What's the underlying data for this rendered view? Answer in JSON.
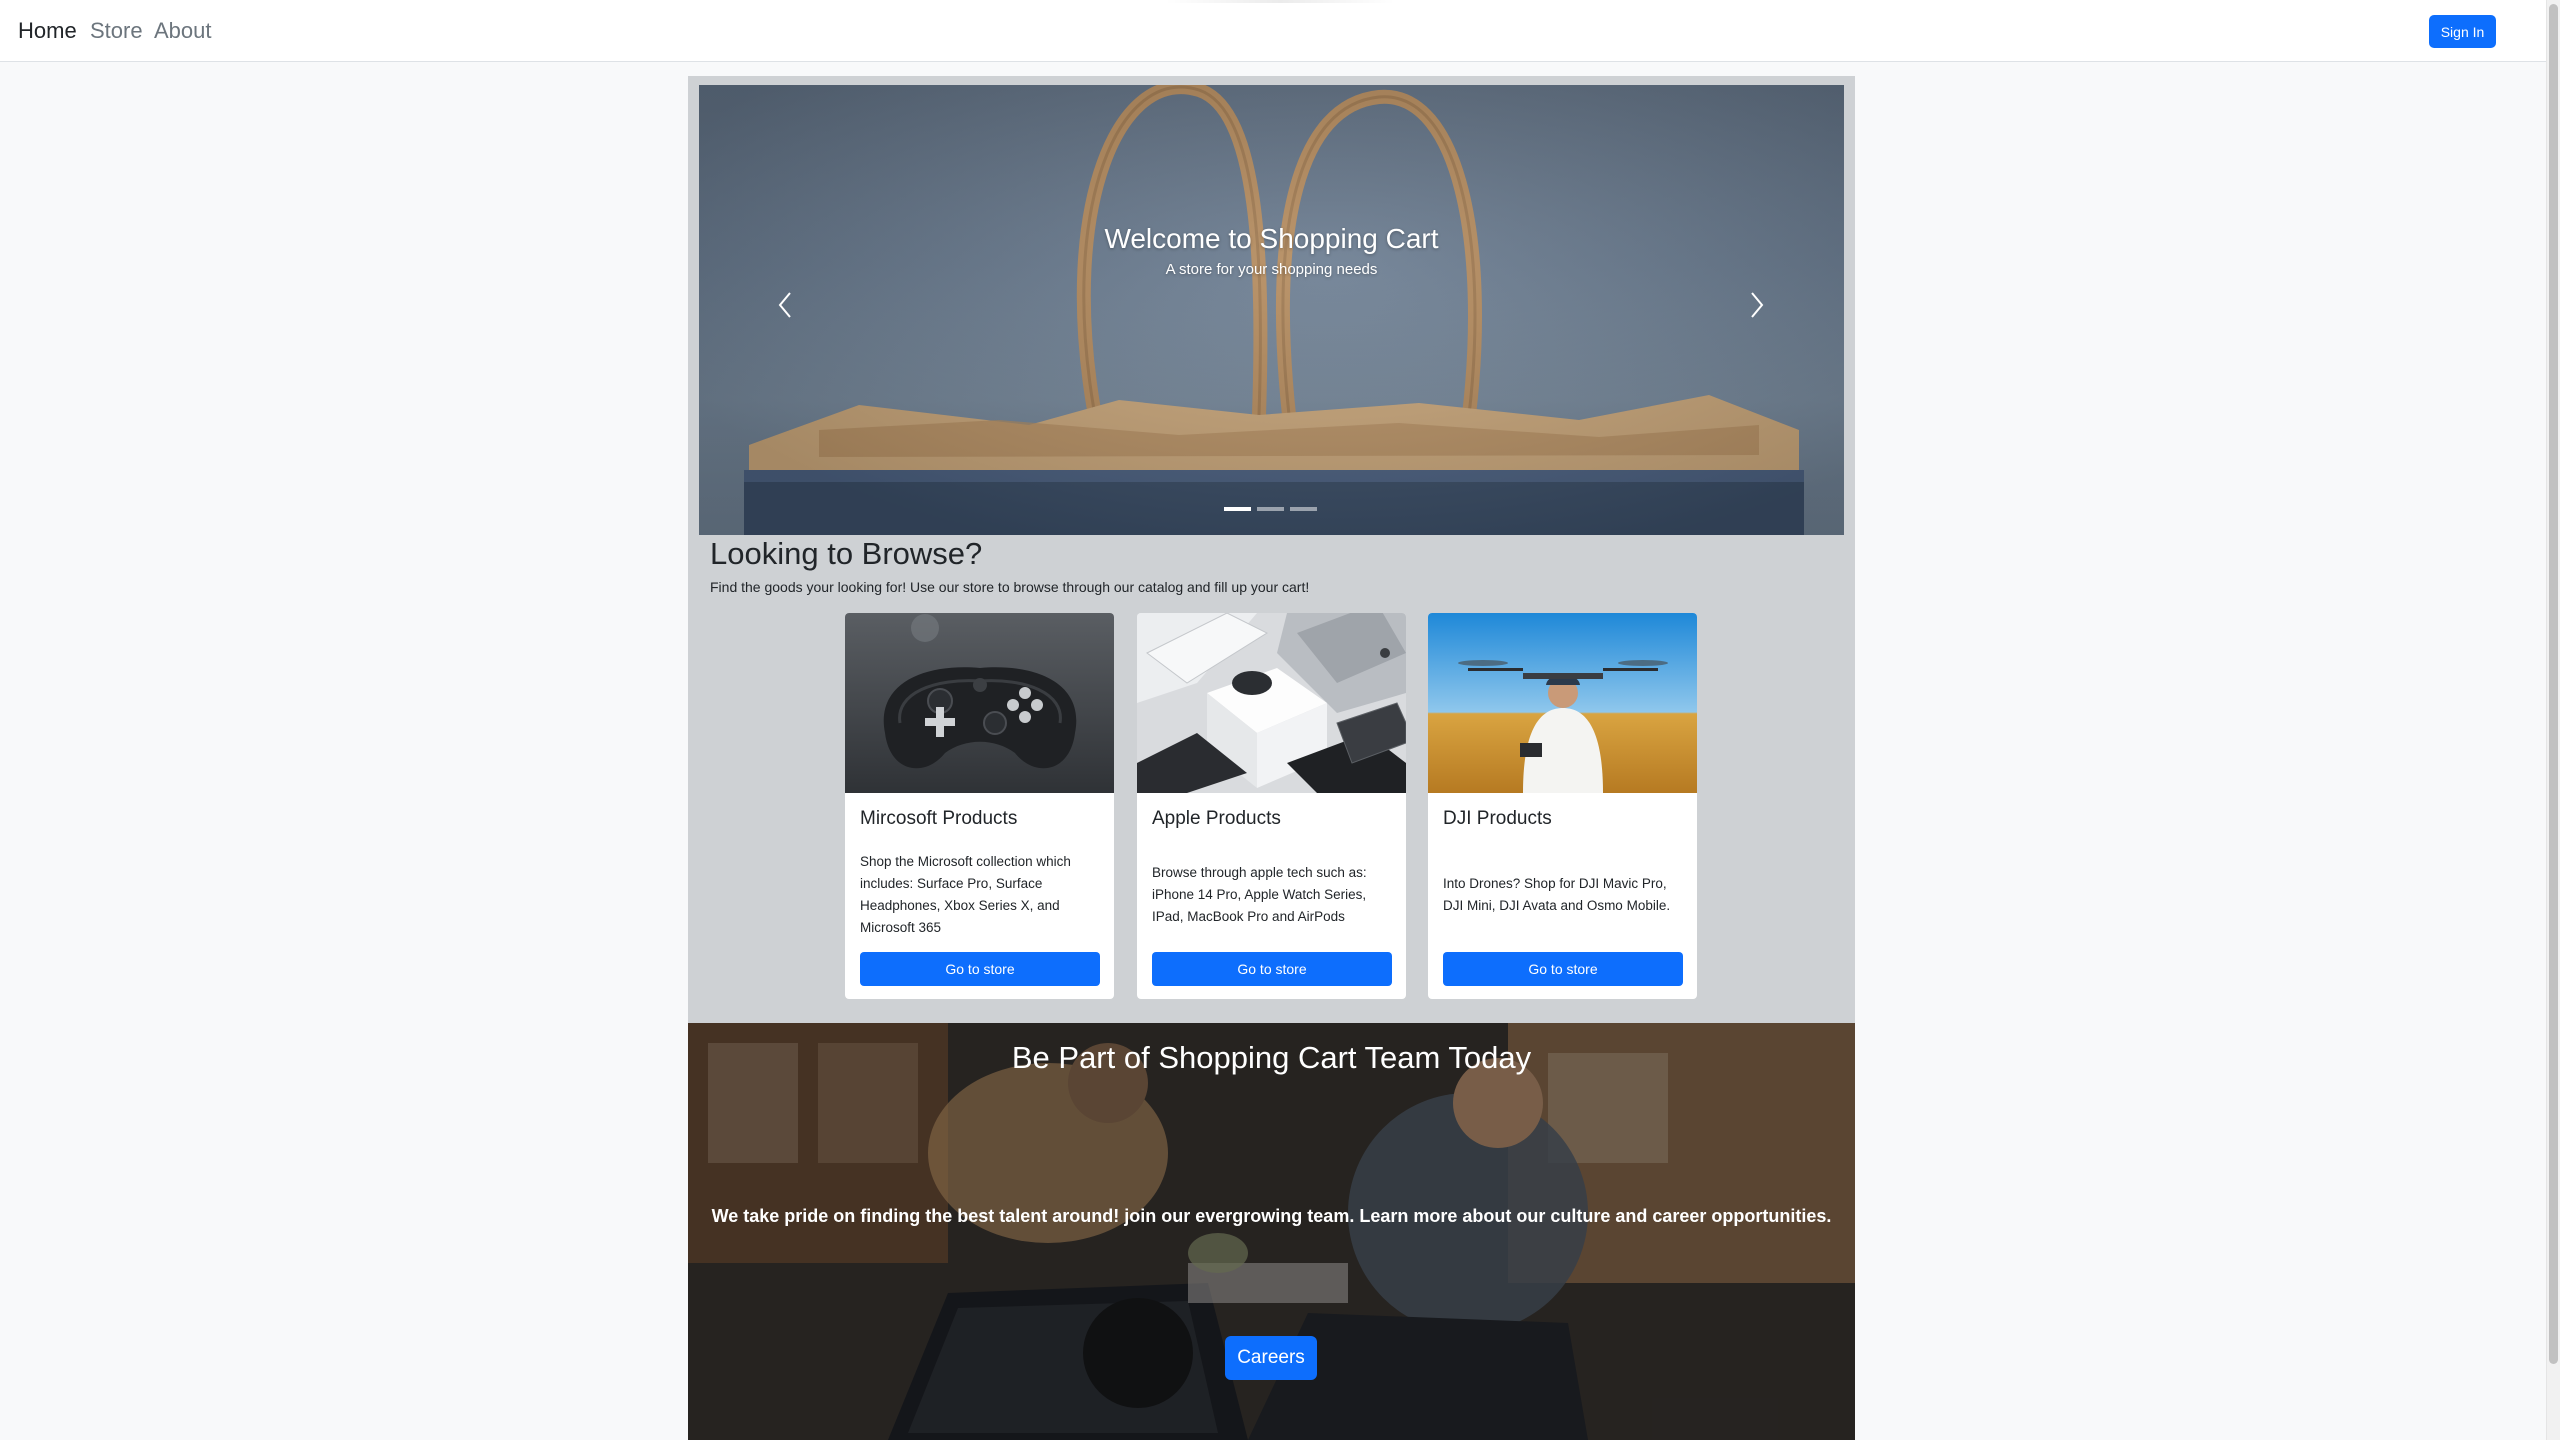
{
  "nav": {
    "links": [
      {
        "label": "Home",
        "active": true
      },
      {
        "label": "Store",
        "active": false
      },
      {
        "label": "About",
        "active": false
      }
    ],
    "signin_label": "Sign In"
  },
  "carousel": {
    "title": "Welcome to Shopping Cart",
    "subtitle": "A store for your shopping needs",
    "slide_count": 3,
    "active_slide": 1
  },
  "browse": {
    "title": "Looking to Browse?",
    "text": "Find the goods your looking for! Use our store to browse through our catalog and fill up your cart!"
  },
  "cards": [
    {
      "title": "Mircosoft Products",
      "text": "Shop the Microsoft collection which includes: Surface Pro, Surface Headphones, Xbox Series X, and Microsoft 365",
      "button": "Go to store"
    },
    {
      "title": "Apple Products",
      "text": "Browse through apple tech such as: iPhone 14 Pro, Apple Watch Series, IPad, MacBook Pro and AirPods",
      "button": "Go to store"
    },
    {
      "title": "DJI Products",
      "text": "Into Drones? Shop for DJI Mavic Pro, DJI Mini, DJI Avata and Osmo Mobile.",
      "button": "Go to store"
    }
  ],
  "careers": {
    "title": "Be Part of Shopping Cart Team Today",
    "text": "We take pride on finding the best talent around! join our evergrowing team. Learn more about our culture and career opportunities.",
    "button": "Careers"
  },
  "colors": {
    "primary": "#0d6efd",
    "container_bg": "#ced1d4",
    "page_bg": "#f8f9fa"
  },
  "icons": {
    "prev": "chevron-left-icon",
    "next": "chevron-right-icon"
  }
}
